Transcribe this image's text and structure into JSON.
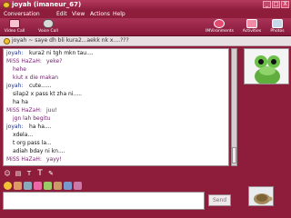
{
  "window": {
    "title": "joyah (imaneur_67)",
    "minimize": "_",
    "maximize": "□",
    "close": "X"
  },
  "menu": [
    "Conversation",
    "Edit",
    "View",
    "Actions",
    "Help"
  ],
  "toolbar": {
    "video_call": "Video Call",
    "voice_call": "Voice Call",
    "imvironments": "IMVironments",
    "activities": "Activities",
    "photos": "Photos"
  },
  "subject": "joyah ~ saye dh bli kura2...aekk nk x....???",
  "messages": [
    {
      "sender": "joyah:",
      "text": "kura2 ni tgh mkn tau....",
      "kind": "me"
    },
    {
      "sender": "MiSS HaZaH:",
      "text": "yeke?",
      "kind": "other"
    },
    {
      "sender": "",
      "text": "hehe",
      "kind": "other"
    },
    {
      "sender": "",
      "text": "kiut x die makan",
      "kind": "other"
    },
    {
      "sender": "joyah:",
      "text": "cute......",
      "kind": "me"
    },
    {
      "sender": "",
      "text": "silap2 x pass kt zha ni.....",
      "kind": "me"
    },
    {
      "sender": "",
      "text": "ha ha",
      "kind": "me"
    },
    {
      "sender": "MiSS HaZaH:",
      "text": "juu!",
      "kind": "other"
    },
    {
      "sender": "",
      "text": "jgn lah begitu",
      "kind": "other"
    },
    {
      "sender": "joyah:",
      "text": "ha ha....",
      "kind": "me"
    },
    {
      "sender": "",
      "text": "xdela...",
      "kind": "me"
    },
    {
      "sender": "",
      "text": "t org pass la...",
      "kind": "me"
    },
    {
      "sender": "",
      "text": "adiah bday ni kn....",
      "kind": "me"
    },
    {
      "sender": "MiSS HaZaH:",
      "text": "yayy!",
      "kind": "other"
    }
  ],
  "format_bar": {
    "font_label": "T",
    "text_size_label": "T"
  },
  "send_label": "Send",
  "colors": {
    "frame": "#8e1d3c",
    "self_name": "#1b2f8f",
    "other_name": "#7a2b75"
  }
}
